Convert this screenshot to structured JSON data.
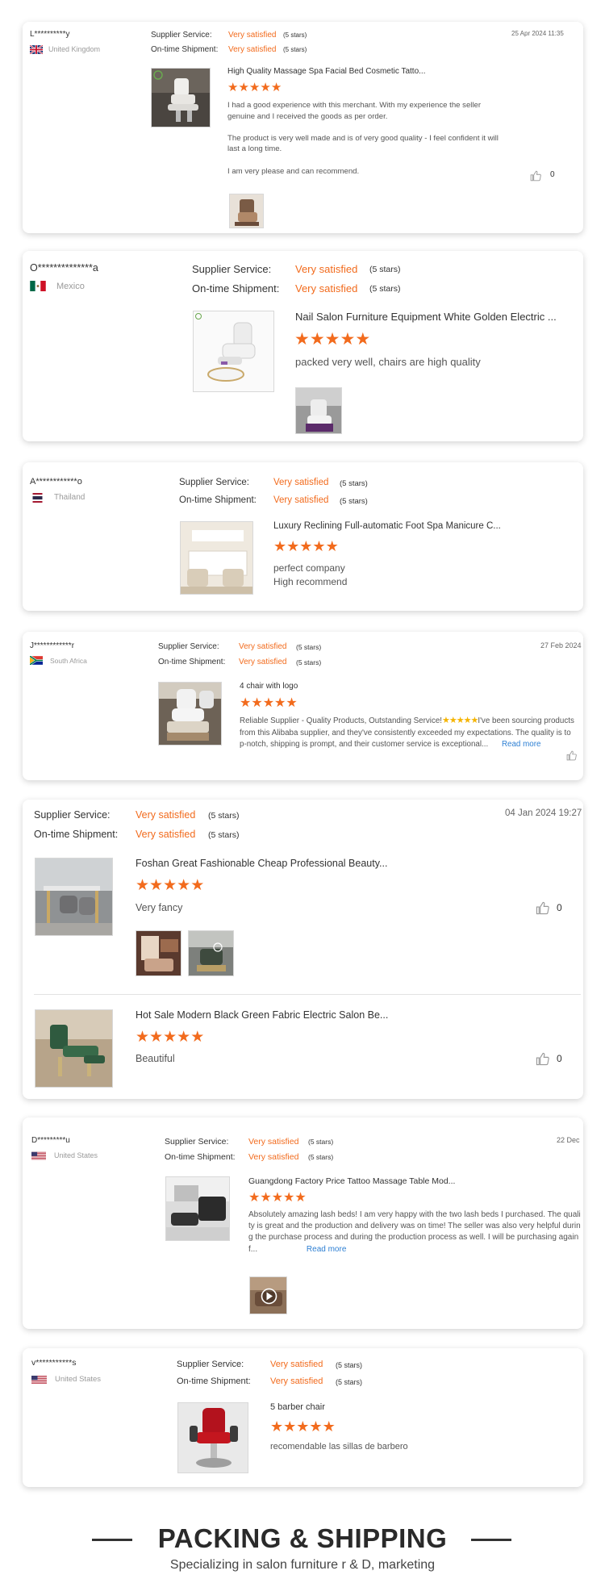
{
  "labels": {
    "supplier_service": "Supplier Service:",
    "ontime_shipment": "On-time Shipment:",
    "very_satisfied": "Very satisfied",
    "five_stars": "(5 stars)",
    "read_more": "Read more"
  },
  "rating_stars": 5,
  "reviews": [
    {
      "reviewer": "L**********y",
      "country": "United Kingdom",
      "date": "25 Apr 2024 11:35",
      "product": "High Quality Massage Spa Facial Bed Cosmetic Tatto...",
      "text": "I had a good experience with this merchant. With my experience the seller genuine and I received the goods as per order.\n\nThe product is very well made and is of very good quality - I feel confident it will last a long time.\n\nI am very please and can recommend.",
      "likes": "0"
    },
    {
      "reviewer": "O**************a",
      "country": "Mexico",
      "product": "Nail Salon Furniture Equipment White Golden Electric ...",
      "text": "packed very well, chairs are high quality"
    },
    {
      "reviewer": "A************o",
      "country": "Thailand",
      "product": "Luxury Reclining Full-automatic Foot Spa Manicure C...",
      "text": "perfect company\nHigh recommend"
    },
    {
      "reviewer": "J************r",
      "country": "South Africa",
      "date": "27 Feb 2024",
      "product": "4 chair with logo",
      "text_before": "Reliable Supplier - Quality Products, Outstanding Service!",
      "text_after": "I've been sourcing products from this Alibaba supplier, and they've consistently exceeded my expectations. The quality is top-notch, shipping is prompt, and their customer service is exceptional..."
    },
    {
      "date": "04 Jan 2024 19:27",
      "items": [
        {
          "product": "Foshan Great Fashionable Cheap Professional Beauty...",
          "text": "Very fancy",
          "likes": "0"
        },
        {
          "product": "Hot Sale Modern Black Green Fabric Electric Salon Be...",
          "text": "Beautiful",
          "likes": "0"
        }
      ]
    },
    {
      "reviewer": "D*********u",
      "country": "United States",
      "date": "22 Dec",
      "product": "Guangdong Factory Price Tattoo Massage Table Mod...",
      "text": "Absolutely amazing lash beds! I am very happy with the two lash beds I purchased. The quality is great and the production and delivery was on time! The seller was also very helpful during the purchase process and during the production process as well. I will be purchasing again f..."
    },
    {
      "reviewer": "v***********s",
      "country": "United States",
      "product": "5 barber chair",
      "text": "recomendable las sillas de barbero"
    }
  ],
  "footer": {
    "heading": "PACKING & SHIPPING",
    "subheading": "Specializing in salon furniture r & D, marketing"
  },
  "colors": {
    "accent": "#f26b1d",
    "link": "#2d7fd3",
    "text": "#333333",
    "muted": "#9a9a9a"
  },
  "icons": [
    "flag-uk-icon",
    "flag-mexico-icon",
    "flag-thailand-icon",
    "flag-south-africa-icon",
    "flag-us-icon",
    "thumbs-up-icon",
    "star-icon",
    "play-icon"
  ]
}
